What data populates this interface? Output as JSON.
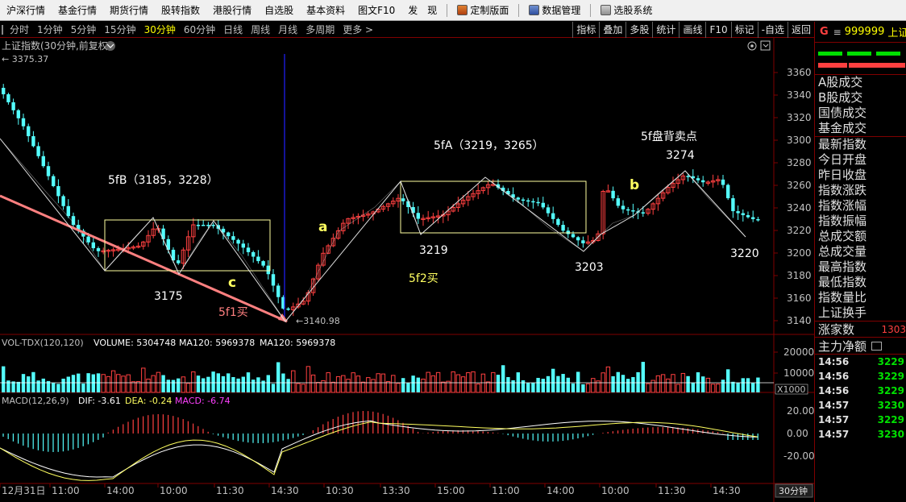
{
  "menu": {
    "items": [
      "沪深行情",
      "基金行情",
      "期货行情",
      "股转指数",
      "港股行情",
      "自选股",
      "基本资料",
      "图文F10",
      "发　现"
    ],
    "tools": [
      "定制版面",
      "数据管理",
      "选股系统"
    ]
  },
  "periods": {
    "items": [
      "分时",
      "1分钟",
      "5分钟",
      "15分钟",
      "30分钟",
      "60分钟",
      "日线",
      "周线",
      "月线",
      "多周期",
      "更多 >"
    ],
    "active": "30分钟"
  },
  "right_buttons": [
    "指标",
    "叠加",
    "多股",
    "统计",
    "画线",
    "F10",
    "标记",
    "-自选",
    "返回"
  ],
  "chart_header": {
    "title": "上证指数(30分钟,前复权)",
    "high_label": "3375.37",
    "low_label": "3140.98"
  },
  "price_axis": {
    "ticks": [
      "3360",
      "3340",
      "3320",
      "3300",
      "3280",
      "3260",
      "3240",
      "3220",
      "3200",
      "3180",
      "3160",
      "3140"
    ]
  },
  "annotations": {
    "fb": "5fB（3185，3228）",
    "fa": "5fA（3219，3265）",
    "bsp": "5f盘背卖点",
    "p3274": "3274",
    "p3175": "3175",
    "c": "c",
    "f1buy": "5f1买",
    "a": "a",
    "p3219": "3219",
    "f2buy": "5f2买",
    "p3203": "3203",
    "b": "b",
    "p3220": "3220"
  },
  "volume": {
    "label": "VOL-TDX(120,120)",
    "volume_text": "VOLUME: 5304748",
    "ma1_text": "MA120: 5969378",
    "ma2_text": "MA120: 5969378",
    "ticks": [
      "20000",
      "10000"
    ],
    "unit": "X1000"
  },
  "macd": {
    "label": "MACD(12,26,9)",
    "dif_text": "DIF: -3.61",
    "dea_text": "DEA: -0.24",
    "macd_text": "MACD: -6.74",
    "ticks": [
      "20.00",
      "0.00",
      "-20.00"
    ]
  },
  "time_axis": [
    "12月31日",
    "11:00",
    "14:00",
    "10:00",
    "11:30",
    "14:30",
    "10:30",
    "13:30",
    "15:00",
    "11:00",
    "14:00",
    "10:00",
    "11:30",
    "14:30"
  ],
  "period_badge": "30分钟",
  "right_panel": {
    "g": "G",
    "eq": "≡",
    "code": "999999",
    "name": "上证",
    "groups": [
      [
        "A股成交",
        "B股成交",
        "国债成交",
        "基金成交"
      ],
      [
        "最新指数",
        "今日开盘",
        "昨日收盘",
        "指数涨跌",
        "指数涨幅",
        "指数振幅",
        "总成交额",
        "总成交量",
        "最高指数",
        "最低指数",
        "指数量比",
        "上证换手"
      ]
    ],
    "zhangjia_label": "涨家数",
    "zhangjia_value": "1303",
    "zhuli_label": "主力净额",
    "ticks": [
      {
        "time": "14:56",
        "value": "3229"
      },
      {
        "time": "14:56",
        "value": "3229"
      },
      {
        "time": "14:56",
        "value": "3229"
      },
      {
        "time": "14:57",
        "value": "3230"
      },
      {
        "time": "14:57",
        "value": "3229"
      },
      {
        "time": "14:57",
        "value": "3230"
      }
    ]
  },
  "colors": {
    "up": "#ff4040",
    "down": "#54ffff",
    "trend_line": "#ff8080",
    "box": "#ffffa0",
    "ma_line": "#ffffff",
    "label_yellow": "#ffff60"
  }
}
